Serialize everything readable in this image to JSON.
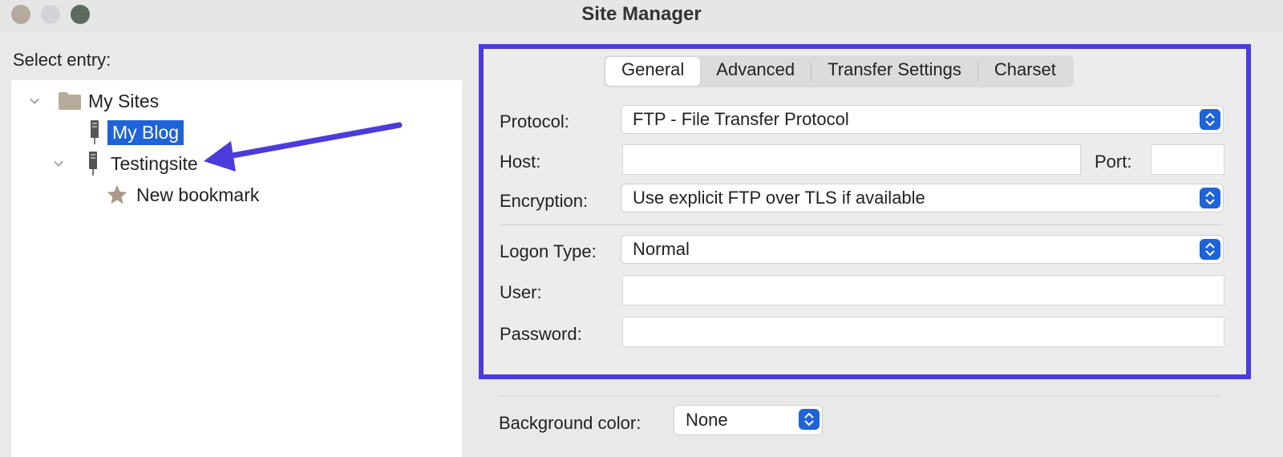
{
  "window": {
    "title": "Site Manager"
  },
  "left": {
    "select_label": "Select entry:",
    "tree": [
      {
        "label": "My Sites",
        "icon": "folder-icon",
        "expanded": true
      },
      {
        "label": "My Blog",
        "icon": "server-icon",
        "selected": true
      },
      {
        "label": "Testingsite",
        "icon": "server-icon",
        "expanded": true
      },
      {
        "label": "New bookmark",
        "icon": "bookmark-star-icon"
      }
    ]
  },
  "tabs": [
    "General",
    "Advanced",
    "Transfer Settings",
    "Charset"
  ],
  "general": {
    "protocol_label": "Protocol:",
    "protocol_value": "FTP - File Transfer Protocol",
    "host_label": "Host:",
    "host_value": "",
    "port_label": "Port:",
    "port_value": "",
    "encryption_label": "Encryption:",
    "encryption_value": "Use explicit FTP over TLS if available",
    "logon_label": "Logon Type:",
    "logon_value": "Normal",
    "user_label": "User:",
    "user_value": "",
    "password_label": "Password:",
    "password_value": ""
  },
  "bottom": {
    "bg_label": "Background color:",
    "bg_value": "None"
  },
  "colors": {
    "highlight": "#4b3bdc",
    "selection": "#1e63d8",
    "stepper": "#1e63d8"
  }
}
